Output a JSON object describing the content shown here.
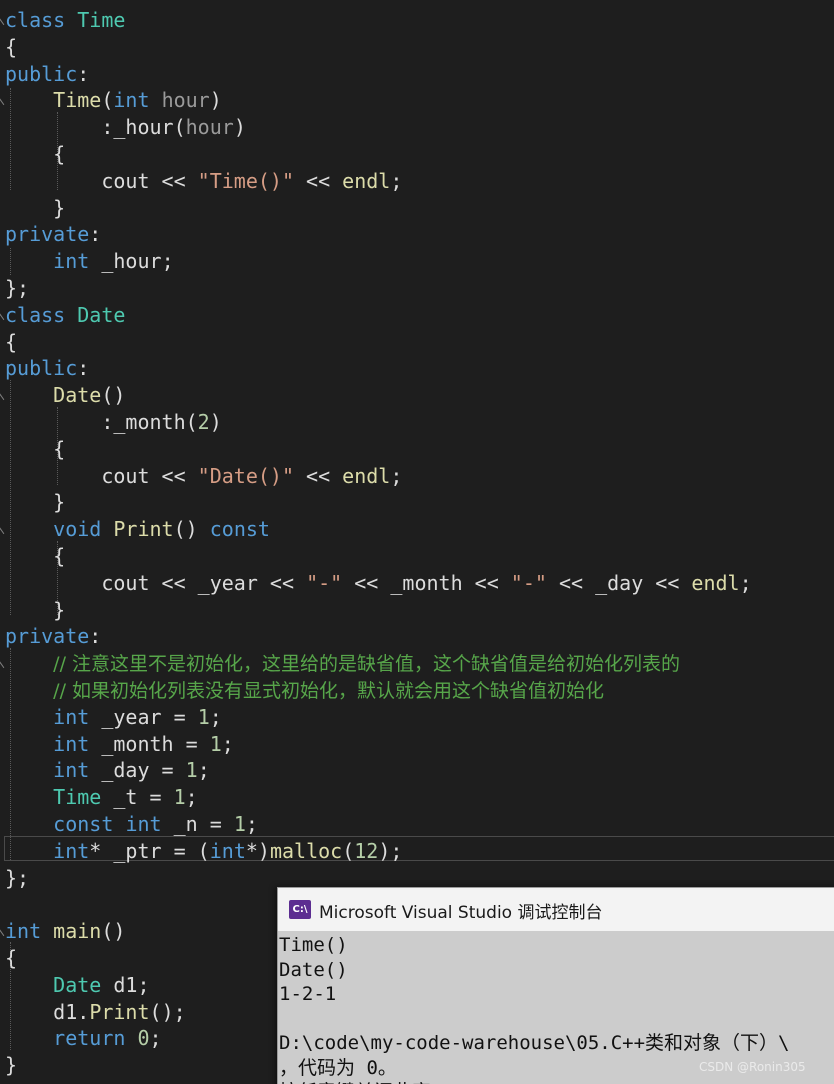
{
  "editor": {
    "code_lines": [
      {
        "fold": true,
        "tokens": [
          {
            "t": "kw",
            "s": "class"
          },
          {
            "t": "op",
            "s": " "
          },
          {
            "t": "type",
            "s": "Time"
          }
        ]
      },
      {
        "fold": false,
        "tokens": [
          {
            "t": "op",
            "s": "{"
          }
        ]
      },
      {
        "fold": false,
        "tokens": [
          {
            "t": "kw",
            "s": "public"
          },
          {
            "t": "op",
            "s": ":"
          }
        ]
      },
      {
        "fold": true,
        "tokens": [
          {
            "t": "op",
            "s": "    "
          },
          {
            "t": "fn",
            "s": "Time"
          },
          {
            "t": "op",
            "s": "("
          },
          {
            "t": "kw",
            "s": "int"
          },
          {
            "t": "op",
            "s": " "
          },
          {
            "t": "prm",
            "s": "hour"
          },
          {
            "t": "op",
            "s": ")"
          }
        ]
      },
      {
        "fold": false,
        "tokens": [
          {
            "t": "op",
            "s": "        :"
          },
          {
            "t": "var",
            "s": "_hour"
          },
          {
            "t": "op",
            "s": "("
          },
          {
            "t": "prm",
            "s": "hour"
          },
          {
            "t": "op",
            "s": ")"
          }
        ]
      },
      {
        "fold": false,
        "tokens": [
          {
            "t": "op",
            "s": "    {"
          }
        ]
      },
      {
        "fold": false,
        "tokens": [
          {
            "t": "op",
            "s": "        "
          },
          {
            "t": "var",
            "s": "cout"
          },
          {
            "t": "op",
            "s": " << "
          },
          {
            "t": "str",
            "s": "\"Time()\""
          },
          {
            "t": "op",
            "s": " << "
          },
          {
            "t": "fn",
            "s": "endl"
          },
          {
            "t": "op",
            "s": ";"
          }
        ]
      },
      {
        "fold": false,
        "tokens": [
          {
            "t": "op",
            "s": "    }"
          }
        ]
      },
      {
        "fold": false,
        "tokens": [
          {
            "t": "kw",
            "s": "private"
          },
          {
            "t": "op",
            "s": ":"
          }
        ]
      },
      {
        "fold": false,
        "tokens": [
          {
            "t": "op",
            "s": "    "
          },
          {
            "t": "kw",
            "s": "int"
          },
          {
            "t": "op",
            "s": " "
          },
          {
            "t": "var",
            "s": "_hour"
          },
          {
            "t": "op",
            "s": ";"
          }
        ]
      },
      {
        "fold": false,
        "tokens": [
          {
            "t": "op",
            "s": "};"
          }
        ]
      },
      {
        "fold": true,
        "tokens": [
          {
            "t": "kw",
            "s": "class"
          },
          {
            "t": "op",
            "s": " "
          },
          {
            "t": "type",
            "s": "Date"
          }
        ]
      },
      {
        "fold": false,
        "tokens": [
          {
            "t": "op",
            "s": "{"
          }
        ]
      },
      {
        "fold": false,
        "tokens": [
          {
            "t": "kw",
            "s": "public"
          },
          {
            "t": "op",
            "s": ":"
          }
        ]
      },
      {
        "fold": true,
        "tokens": [
          {
            "t": "op",
            "s": "    "
          },
          {
            "t": "fn",
            "s": "Date"
          },
          {
            "t": "op",
            "s": "()"
          }
        ]
      },
      {
        "fold": false,
        "tokens": [
          {
            "t": "op",
            "s": "        :"
          },
          {
            "t": "var",
            "s": "_month"
          },
          {
            "t": "op",
            "s": "("
          },
          {
            "t": "num",
            "s": "2"
          },
          {
            "t": "op",
            "s": ")"
          }
        ]
      },
      {
        "fold": false,
        "tokens": [
          {
            "t": "op",
            "s": "    {"
          }
        ]
      },
      {
        "fold": false,
        "tokens": [
          {
            "t": "op",
            "s": "        "
          },
          {
            "t": "var",
            "s": "cout"
          },
          {
            "t": "op",
            "s": " << "
          },
          {
            "t": "str",
            "s": "\"Date()\""
          },
          {
            "t": "op",
            "s": " << "
          },
          {
            "t": "fn",
            "s": "endl"
          },
          {
            "t": "op",
            "s": ";"
          }
        ]
      },
      {
        "fold": false,
        "tokens": [
          {
            "t": "op",
            "s": "    }"
          }
        ]
      },
      {
        "fold": true,
        "tokens": [
          {
            "t": "op",
            "s": "    "
          },
          {
            "t": "kw",
            "s": "void"
          },
          {
            "t": "op",
            "s": " "
          },
          {
            "t": "fn",
            "s": "Print"
          },
          {
            "t": "op",
            "s": "() "
          },
          {
            "t": "kw",
            "s": "const"
          }
        ]
      },
      {
        "fold": false,
        "tokens": [
          {
            "t": "op",
            "s": "    {"
          }
        ]
      },
      {
        "fold": false,
        "tokens": [
          {
            "t": "op",
            "s": "        "
          },
          {
            "t": "var",
            "s": "cout"
          },
          {
            "t": "op",
            "s": " << "
          },
          {
            "t": "var",
            "s": "_year"
          },
          {
            "t": "op",
            "s": " << "
          },
          {
            "t": "str",
            "s": "\"-\""
          },
          {
            "t": "op",
            "s": " << "
          },
          {
            "t": "var",
            "s": "_month"
          },
          {
            "t": "op",
            "s": " << "
          },
          {
            "t": "str",
            "s": "\"-\""
          },
          {
            "t": "op",
            "s": " << "
          },
          {
            "t": "var",
            "s": "_day"
          },
          {
            "t": "op",
            "s": " << "
          },
          {
            "t": "fn",
            "s": "endl"
          },
          {
            "t": "op",
            "s": ";"
          }
        ]
      },
      {
        "fold": false,
        "tokens": [
          {
            "t": "op",
            "s": "    }"
          }
        ]
      },
      {
        "fold": false,
        "tokens": [
          {
            "t": "kw",
            "s": "private"
          },
          {
            "t": "op",
            "s": ":"
          }
        ]
      },
      {
        "fold": true,
        "tokens": [
          {
            "t": "op",
            "s": "    "
          },
          {
            "t": "cmt",
            "s": "// 注意这里不是初始化，这里给的是缺省值，这个缺省值是给初始化列表的"
          }
        ]
      },
      {
        "fold": false,
        "tokens": [
          {
            "t": "op",
            "s": "    "
          },
          {
            "t": "cmt",
            "s": "// 如果初始化列表没有显式初始化，默认就会用这个缺省值初始化"
          }
        ]
      },
      {
        "fold": false,
        "tokens": [
          {
            "t": "op",
            "s": "    "
          },
          {
            "t": "kw",
            "s": "int"
          },
          {
            "t": "op",
            "s": " "
          },
          {
            "t": "var",
            "s": "_year"
          },
          {
            "t": "op",
            "s": " = "
          },
          {
            "t": "num",
            "s": "1"
          },
          {
            "t": "op",
            "s": ";"
          }
        ]
      },
      {
        "fold": false,
        "tokens": [
          {
            "t": "op",
            "s": "    "
          },
          {
            "t": "kw",
            "s": "int"
          },
          {
            "t": "op",
            "s": " "
          },
          {
            "t": "var",
            "s": "_month"
          },
          {
            "t": "op",
            "s": " = "
          },
          {
            "t": "num",
            "s": "1"
          },
          {
            "t": "op",
            "s": ";"
          }
        ]
      },
      {
        "fold": false,
        "tokens": [
          {
            "t": "op",
            "s": "    "
          },
          {
            "t": "kw",
            "s": "int"
          },
          {
            "t": "op",
            "s": " "
          },
          {
            "t": "var",
            "s": "_day"
          },
          {
            "t": "op",
            "s": " = "
          },
          {
            "t": "num",
            "s": "1"
          },
          {
            "t": "op",
            "s": ";"
          }
        ]
      },
      {
        "fold": false,
        "tokens": [
          {
            "t": "op",
            "s": "    "
          },
          {
            "t": "type",
            "s": "Time"
          },
          {
            "t": "op",
            "s": " "
          },
          {
            "t": "var",
            "s": "_t"
          },
          {
            "t": "op",
            "s": " = "
          },
          {
            "t": "num",
            "s": "1"
          },
          {
            "t": "op",
            "s": ";"
          }
        ]
      },
      {
        "fold": false,
        "tokens": [
          {
            "t": "op",
            "s": "    "
          },
          {
            "t": "kw",
            "s": "const"
          },
          {
            "t": "op",
            "s": " "
          },
          {
            "t": "kw",
            "s": "int"
          },
          {
            "t": "op",
            "s": " "
          },
          {
            "t": "var",
            "s": "_n"
          },
          {
            "t": "op",
            "s": " = "
          },
          {
            "t": "num",
            "s": "1"
          },
          {
            "t": "op",
            "s": ";"
          }
        ]
      },
      {
        "fold": false,
        "tokens": [
          {
            "t": "op",
            "s": "    "
          },
          {
            "t": "kw",
            "s": "int"
          },
          {
            "t": "op",
            "s": "* "
          },
          {
            "t": "var",
            "s": "_ptr"
          },
          {
            "t": "op",
            "s": " = ("
          },
          {
            "t": "kw",
            "s": "int"
          },
          {
            "t": "op",
            "s": "*)"
          },
          {
            "t": "fn",
            "s": "malloc"
          },
          {
            "t": "op",
            "s": "("
          },
          {
            "t": "num",
            "s": "12"
          },
          {
            "t": "op",
            "s": ");"
          }
        ]
      },
      {
        "fold": false,
        "tokens": [
          {
            "t": "op",
            "s": "};"
          }
        ]
      },
      {
        "fold": false,
        "tokens": []
      },
      {
        "fold": true,
        "tokens": [
          {
            "t": "kw",
            "s": "int"
          },
          {
            "t": "op",
            "s": " "
          },
          {
            "t": "fn",
            "s": "main"
          },
          {
            "t": "op",
            "s": "()"
          }
        ]
      },
      {
        "fold": false,
        "tokens": [
          {
            "t": "op",
            "s": "{"
          }
        ]
      },
      {
        "fold": false,
        "tokens": [
          {
            "t": "op",
            "s": "    "
          },
          {
            "t": "type",
            "s": "Date"
          },
          {
            "t": "op",
            "s": " "
          },
          {
            "t": "var",
            "s": "d1"
          },
          {
            "t": "op",
            "s": ";"
          }
        ]
      },
      {
        "fold": false,
        "tokens": [
          {
            "t": "op",
            "s": "    "
          },
          {
            "t": "var",
            "s": "d1"
          },
          {
            "t": "op",
            "s": "."
          },
          {
            "t": "fn",
            "s": "Print"
          },
          {
            "t": "op",
            "s": "();"
          }
        ]
      },
      {
        "fold": false,
        "tokens": [
          {
            "t": "op",
            "s": "    "
          },
          {
            "t": "kw",
            "s": "return"
          },
          {
            "t": "op",
            "s": " "
          },
          {
            "t": "num",
            "s": "0"
          },
          {
            "t": "op",
            "s": ";"
          }
        ]
      },
      {
        "fold": false,
        "tokens": [
          {
            "t": "op",
            "s": "}"
          }
        ]
      }
    ]
  },
  "console": {
    "title": "Microsoft Visual Studio 调试控制台",
    "icon_label": "C:\\",
    "icon": "console-app-icon",
    "accent_color": "#5c2d91",
    "lines": [
      "Time()",
      "Date()",
      "1-2-1",
      "",
      "D:\\code\\my-code-warehouse\\05.C++类和对象（下）\\",
      "，代码为 0。",
      "按任意键关闭此窗口. . ."
    ]
  },
  "watermark": "CSDN @Ronin305"
}
